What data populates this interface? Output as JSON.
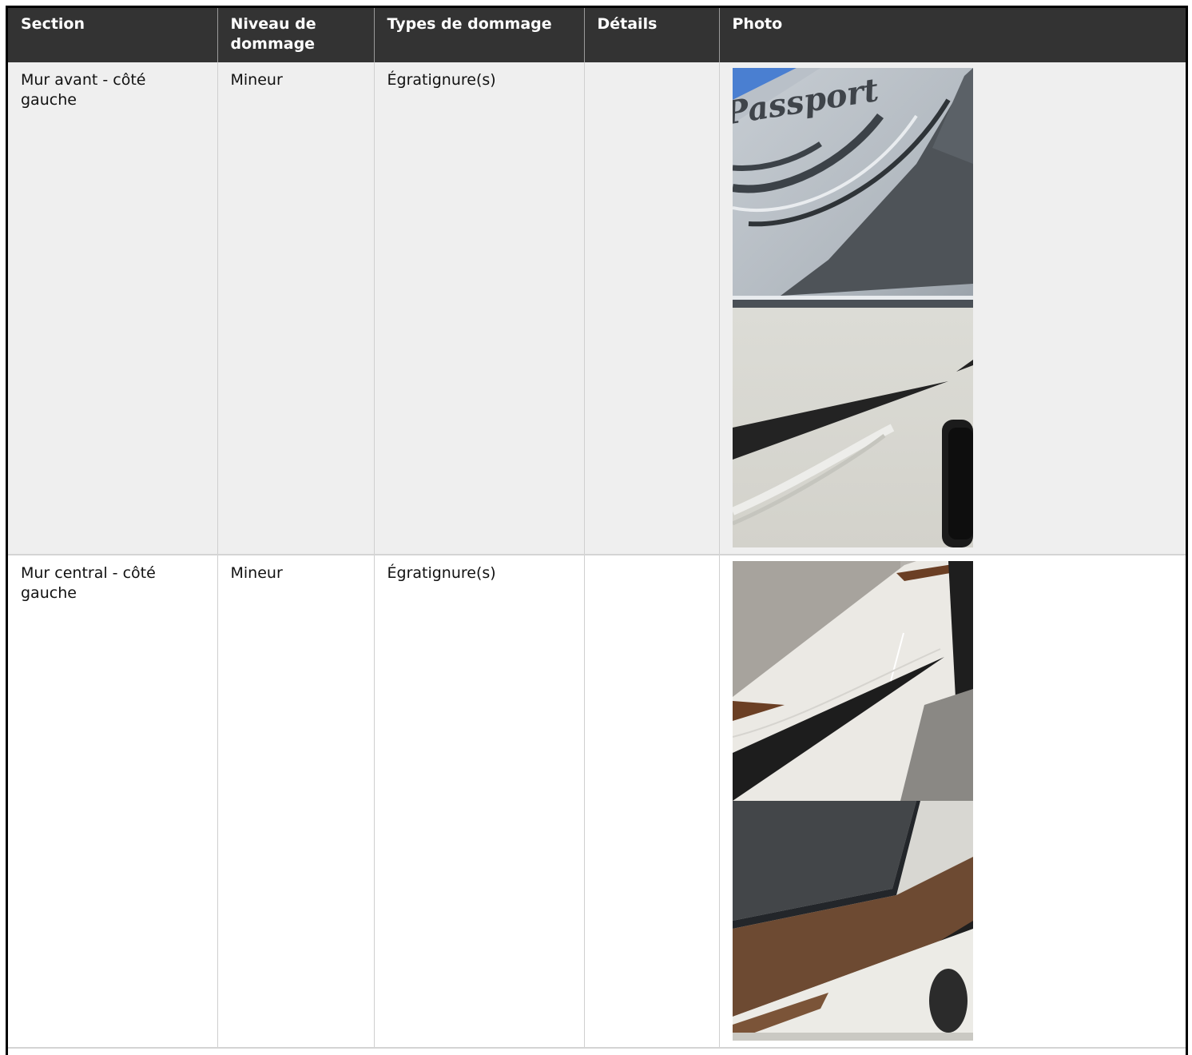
{
  "table": {
    "headers": {
      "section": "Section",
      "level": "Niveau de dommage",
      "types": "Types de dommage",
      "details": "Détails",
      "photo": "Photo"
    },
    "rows": [
      {
        "section": "Mur avant - côté gauche",
        "level": "Mineur",
        "types": "Égratignure(s)",
        "details": "",
        "photos": [
          "trailer-front-wall-decal-photo",
          "trailer-side-stripe-photo"
        ]
      },
      {
        "section": "Mur central - côté gauche",
        "level": "Mineur",
        "types": "Égratignure(s)",
        "details": "",
        "photos": [
          "trailer-mid-wall-scratch-photo",
          "trailer-slideout-corner-photo"
        ]
      }
    ]
  },
  "photo_logo_text": "Passport",
  "colors": {
    "header_bg": "#333333",
    "header_text": "#ffffff",
    "row_shaded": "#efefef",
    "row_plain": "#ffffff"
  }
}
